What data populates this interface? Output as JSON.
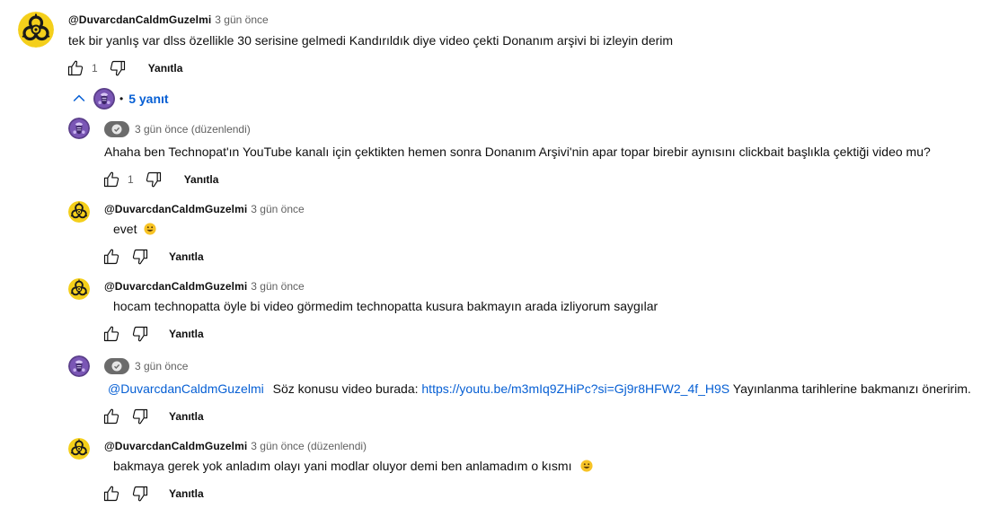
{
  "top_comment": {
    "author": "@DuvarcdanCaldmGuzelmi",
    "time": "3 gün önce",
    "text": "tek bir yanlış var dlss özellikle 30 serisine gelmedi Kandırıldık diye video çekti Donanım arşivi bi izleyin derim",
    "like_count": "1",
    "reply_label": "Yanıtla"
  },
  "replies_toggle": {
    "separator": "•",
    "label": "5 yanıt"
  },
  "replies": [
    {
      "author": "",
      "time": "3 gün önce (düzenlendi)",
      "text": "Ahaha ben Technopat'ın YouTube kanalı için çektikten hemen sonra Donanım Arşivi'nin apar topar birebir aynısını clickbait başlıkla çektiği video mu?",
      "like_count": "1",
      "reply_label": "Yanıtla"
    },
    {
      "author": "@DuvarcdanCaldmGuzelmi",
      "time": "3 gün önce",
      "text": "evet",
      "reply_label": "Yanıtla"
    },
    {
      "author": "@DuvarcdanCaldmGuzelmi",
      "time": "3 gün önce",
      "text": "hocam technopatta öyle bi video görmedim technopatta kusura bakmayın arada izliyorum saygılar",
      "reply_label": "Yanıtla"
    },
    {
      "author": "",
      "time": "3 gün önce",
      "mention": "@DuvarcdanCaldmGuzelmi",
      "text_before_link": "Söz konusu video burada:",
      "link": "https://youtu.be/m3mIq9ZHiPc?si=Gj9r8HFW2_4f_H9S",
      "text_after_link": "Yayınlanma tarihlerine bakmanızı öneririm.",
      "reply_label": "Yanıtla"
    },
    {
      "author": "@DuvarcdanCaldmGuzelmi",
      "time": "3 gün önce (düzenlendi)",
      "text": "bakmaya gerek yok anladım olayı yani modlar oluyor demi ben anlamadım o kısmı",
      "reply_label": "Yanıtla"
    }
  ],
  "icons": {
    "avatar_user": "biohazard-avatar",
    "avatar_creator": "purple-logo-avatar",
    "like": "thumbs-up-icon",
    "dislike": "thumbs-down-icon",
    "collapse": "chevron-up-icon",
    "verified": "check-badge-icon",
    "emoji": "smiley-emoji"
  },
  "colors": {
    "link": "#065fd4",
    "meta": "#606060",
    "badge": "#6b6b6b",
    "creator_avatar": "#5b3f8a"
  }
}
